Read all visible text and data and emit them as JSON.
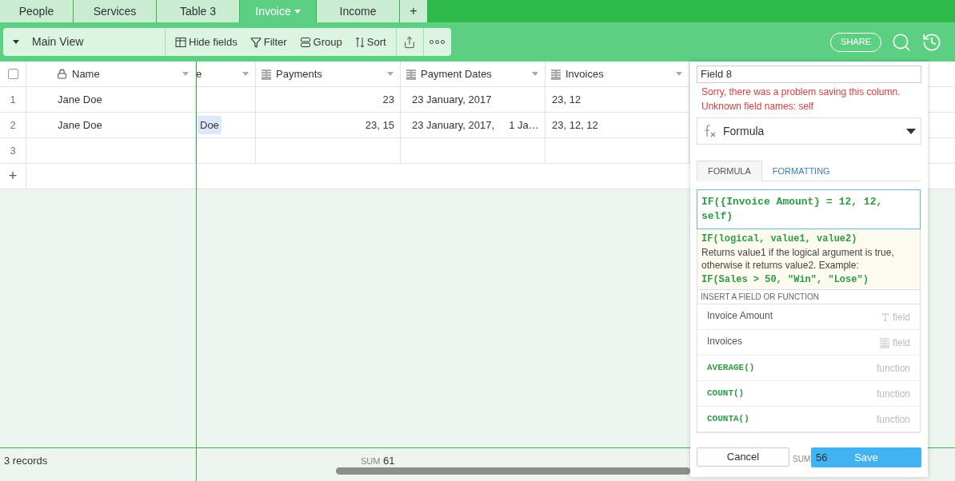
{
  "tabs": [
    {
      "label": "People",
      "selected": false
    },
    {
      "label": "Services",
      "selected": false
    },
    {
      "label": "Table 3",
      "selected": false
    },
    {
      "label": "Invoice",
      "selected": true
    },
    {
      "label": "Income",
      "selected": false
    }
  ],
  "add_tab": "+",
  "toolbar": {
    "view": "Main View",
    "buttons": [
      {
        "label": "Hide fields",
        "kind": "hide"
      },
      {
        "label": "Filter",
        "kind": "filter"
      },
      {
        "label": "Group",
        "kind": "group"
      },
      {
        "label": "Sort",
        "kind": "sort"
      }
    ],
    "share": "SHARE"
  },
  "table": {
    "select_all": {
      "checked": false
    },
    "columns": [
      {
        "label": "Name",
        "kind": "primary"
      },
      {
        "label": "e",
        "kind": "partial"
      },
      {
        "label": "Payments",
        "kind": "link"
      },
      {
        "label": "Payment Dates",
        "kind": "link"
      },
      {
        "label": "Invoices",
        "kind": "link"
      }
    ],
    "rows": [
      {
        "number": "1",
        "name": "Jane Doe",
        "column_2": [],
        "payments": "23",
        "payment_dates": [
          "23 January, 2017"
        ],
        "invoices": "23, 12"
      },
      {
        "number": "2",
        "name": "Jane Doe",
        "column_2": [
          "Doe"
        ],
        "payments": "23, 15",
        "payment_dates": [
          "23 January, 2017,",
          "1 Ja…"
        ],
        "invoices": "23, 12, 12"
      },
      {
        "number": "3"
      }
    ],
    "add_row": "+"
  },
  "footer": {
    "records": "3 records",
    "sum_label": "SUM",
    "sum": "61",
    "sum_label_2": "SUM",
    "sum_2": "56"
  },
  "panel": {
    "field_name": "Field 8",
    "errors": [
      "Sorry, there was a problem saving this column.",
      "Unknown field names: self"
    ],
    "type": "Formula",
    "tabs": [
      {
        "label": "FORMULA",
        "selected": true
      },
      {
        "label": "FORMATTING",
        "selected": false
      }
    ],
    "formula": "IF({Invoice Amount} = 12, 12, self)",
    "help": {
      "signature": "IF(logical, value1, value2)",
      "description": "Returns value1 if the logical argument is true, otherwise it returns value2. Example:",
      "example": "IF(Sales > 50, \"Win\", \"Lose\")"
    },
    "section": "INSERT A FIELD OR FUNCTION",
    "items": [
      {
        "label": "Invoice Amount",
        "kind": "text_field",
        "type": "field"
      },
      {
        "label": "Invoices",
        "kind": "link_field",
        "type": "field"
      },
      {
        "label": "AVERAGE()",
        "kind": "function",
        "type": "function"
      },
      {
        "label": "COUNT()",
        "kind": "function",
        "type": "function"
      },
      {
        "label": "COUNTA()",
        "kind": "function",
        "type": "function"
      }
    ],
    "cancel": "Cancel",
    "save": "Save"
  }
}
